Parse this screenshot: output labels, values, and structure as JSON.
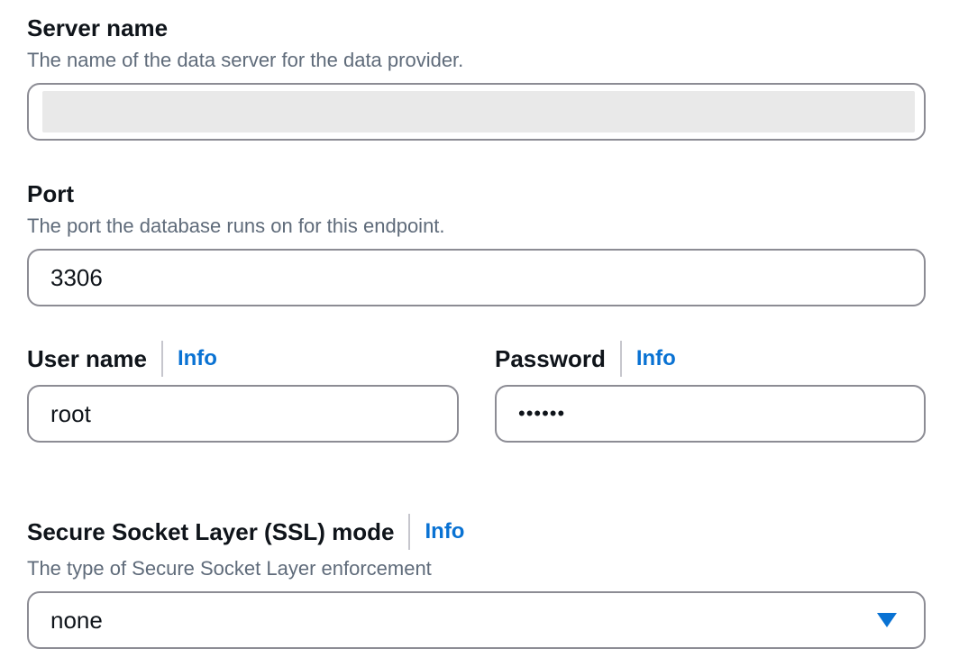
{
  "server": {
    "label": "Server name",
    "description": "The name of the data server for the data provider.",
    "value": ""
  },
  "port": {
    "label": "Port",
    "description": "The port the database runs on for this endpoint.",
    "value": "3306"
  },
  "username": {
    "label": "User name",
    "info": "Info",
    "value": "root"
  },
  "password": {
    "label": "Password",
    "info": "Info",
    "value": "••••••"
  },
  "ssl": {
    "label": "Secure Socket Layer (SSL) mode",
    "info": "Info",
    "description": "The type of Secure Socket Layer enforcement",
    "value": "none"
  },
  "colors": {
    "link": "#0972d3",
    "border": "#8c8c94",
    "description": "#5f6b7a",
    "masked": "#e9e9e9"
  },
  "icons": {
    "select_caret": "caret-down-icon"
  }
}
